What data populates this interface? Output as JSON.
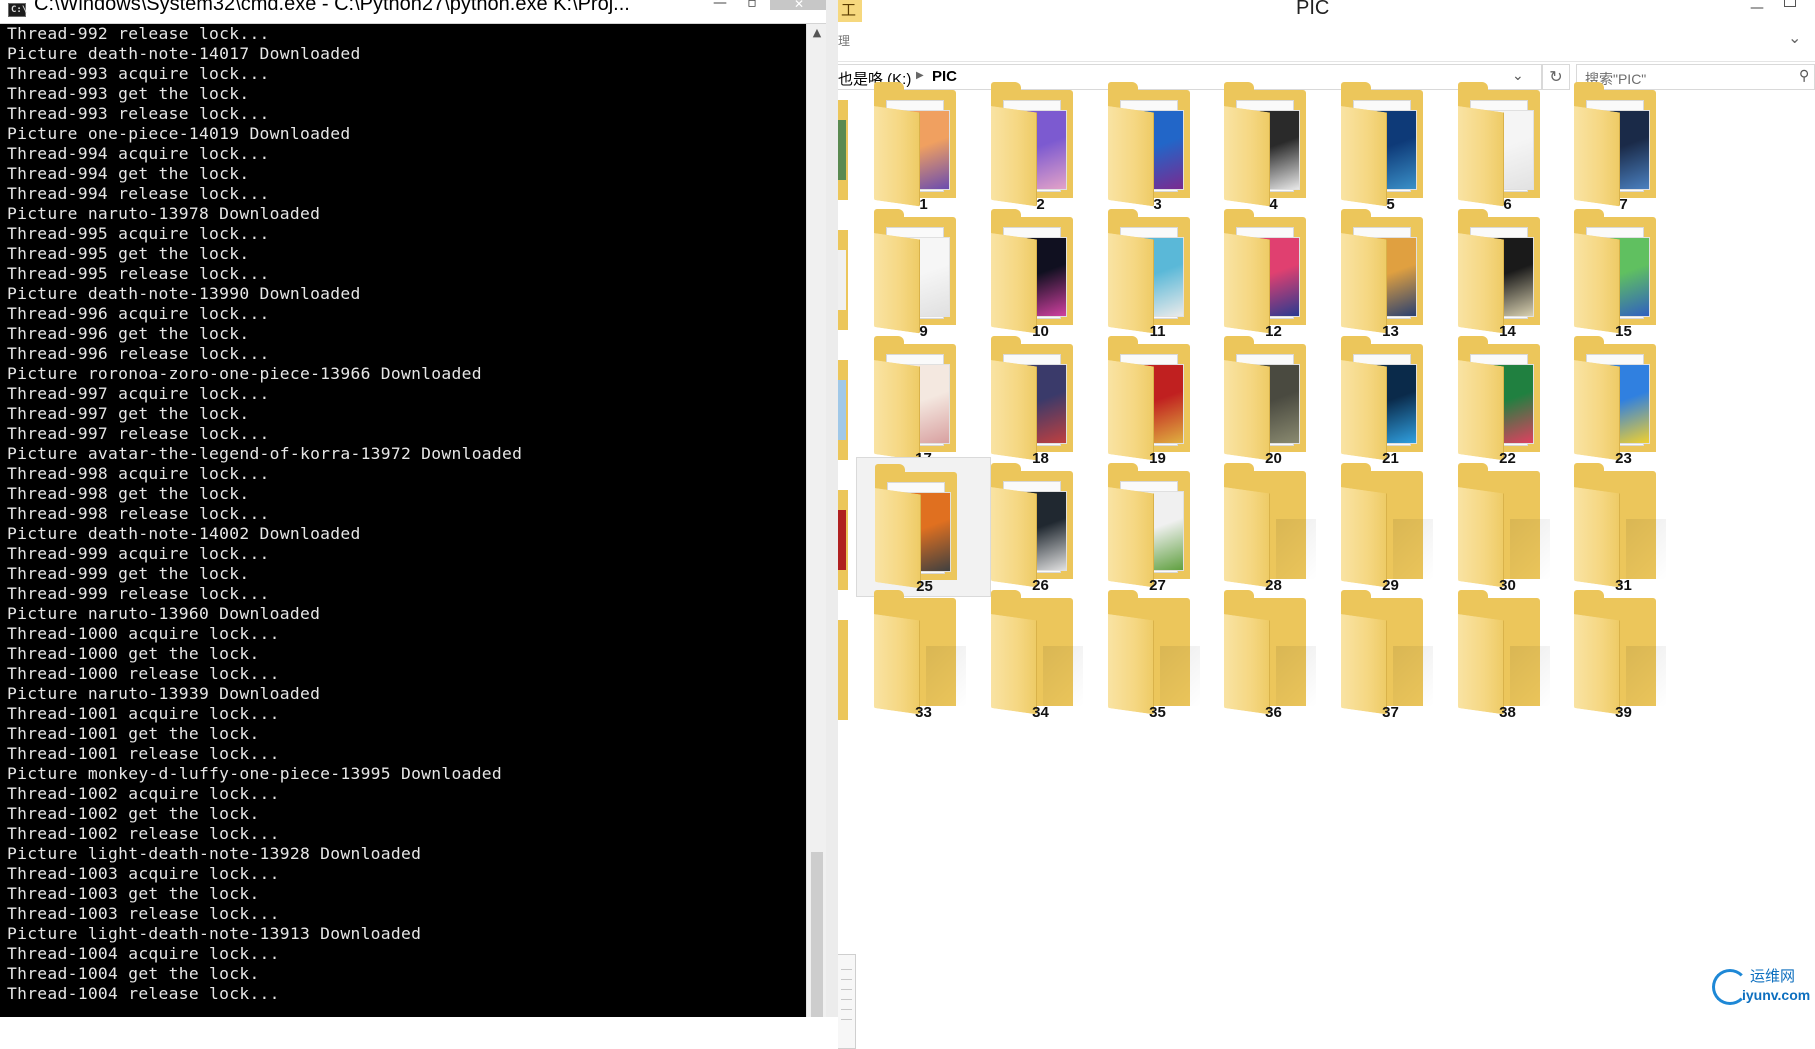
{
  "cmd": {
    "title": "C:\\Windows\\System32\\cmd.exe - C:\\Python27\\python.exe    K:\\Proj...",
    "icon_label": "C:\\",
    "minimize_icon": "minimize-icon",
    "lines": [
      "Thread-992 release lock...",
      "Picture death-note-14017 Downloaded",
      "Thread-993 acquire lock...",
      "Thread-993 get the lock.",
      "Thread-993 release lock...",
      "Picture one-piece-14019 Downloaded",
      "Thread-994 acquire lock...",
      "Thread-994 get the lock.",
      "Thread-994 release lock...",
      "Picture naruto-13978 Downloaded",
      "Thread-995 acquire lock...",
      "Thread-995 get the lock.",
      "Thread-995 release lock...",
      "Picture death-note-13990 Downloaded",
      "Thread-996 acquire lock...",
      "Thread-996 get the lock.",
      "Thread-996 release lock...",
      "Picture roronoa-zoro-one-piece-13966 Downloaded",
      "Thread-997 acquire lock...",
      "Thread-997 get the lock.",
      "Thread-997 release lock...",
      "Picture avatar-the-legend-of-korra-13972 Downloaded",
      "Thread-998 acquire lock...",
      "Thread-998 get the lock.",
      "Thread-998 release lock...",
      "Picture death-note-14002 Downloaded",
      "Thread-999 acquire lock...",
      "Thread-999 get the lock.",
      "Thread-999 release lock...",
      "Picture naruto-13960 Downloaded",
      "Thread-1000 acquire lock...",
      "Thread-1000 get the lock.",
      "Thread-1000 release lock...",
      "Picture naruto-13939 Downloaded",
      "Thread-1001 acquire lock...",
      "Thread-1001 get the lock.",
      "Thread-1001 release lock...",
      "Picture monkey-d-luffy-one-piece-13995 Downloaded",
      "Thread-1002 acquire lock...",
      "Thread-1002 get the lock.",
      "Thread-1002 release lock...",
      "Picture light-death-note-13928 Downloaded",
      "Thread-1003 acquire lock...",
      "Thread-1003 get the lock.",
      "Thread-1003 release lock...",
      "Picture light-death-note-13913 Downloaded",
      "Thread-1004 acquire lock...",
      "Thread-1004 get the lock.",
      "Thread-1004 release lock..."
    ]
  },
  "explorer": {
    "ribbon_tab": "工具",
    "title": "PIC",
    "ribbon_mark": "理",
    "breadcrumb": [
      "也是咯 (K:)",
      "PIC"
    ],
    "search_placeholder": "搜索\"PIC\"",
    "colors": {
      "folder": "#ecc65b",
      "selection": "#f2f2f2",
      "accent": "#1e88d6"
    },
    "folders": [
      {
        "label": "1",
        "thumb": [
          "#f0a060",
          "#6a4cb0"
        ]
      },
      {
        "label": "2",
        "thumb": [
          "#7c5ad0",
          "#e3a2c8"
        ]
      },
      {
        "label": "3",
        "thumb": [
          "#2266c8",
          "#7a2a90"
        ]
      },
      {
        "label": "4",
        "thumb": [
          "#2a2a2a",
          "#e8e8e8"
        ]
      },
      {
        "label": "5",
        "thumb": [
          "#0e3a78",
          "#3a90c8"
        ]
      },
      {
        "label": "6",
        "thumb": [
          "#f5f5f5",
          "#e2e2e2"
        ]
      },
      {
        "label": "7",
        "thumb": [
          "#1a2a48",
          "#4a80c0"
        ]
      },
      {
        "label": "9",
        "thumb": [
          "#f6f6f6",
          "#e0e0e0"
        ]
      },
      {
        "label": "10",
        "thumb": [
          "#101020",
          "#d040a0"
        ]
      },
      {
        "label": "11",
        "thumb": [
          "#5ab8d8",
          "#eaeaea"
        ]
      },
      {
        "label": "12",
        "thumb": [
          "#e04070",
          "#2a3a90"
        ]
      },
      {
        "label": "13",
        "thumb": [
          "#e0a040",
          "#2a4070"
        ]
      },
      {
        "label": "14",
        "thumb": [
          "#1a1a1a",
          "#d8d0b0"
        ]
      },
      {
        "label": "15",
        "thumb": [
          "#60c060",
          "#3060c0"
        ]
      },
      {
        "label": "17",
        "thumb": [
          "#f4e8e0",
          "#d8a0a0"
        ]
      },
      {
        "label": "18",
        "thumb": [
          "#3a3a6a",
          "#c04040"
        ]
      },
      {
        "label": "19",
        "thumb": [
          "#c02020",
          "#e0b040"
        ]
      },
      {
        "label": "20",
        "thumb": [
          "#4a4a40",
          "#8a8a70"
        ]
      },
      {
        "label": "21",
        "thumb": [
          "#0a2a4a",
          "#30a0e0"
        ]
      },
      {
        "label": "22",
        "thumb": [
          "#208040",
          "#e04060"
        ]
      },
      {
        "label": "23",
        "thumb": [
          "#3080e0",
          "#f0d030"
        ]
      },
      {
        "label": "25",
        "thumb": [
          "#e07020",
          "#404040"
        ],
        "selected": true
      },
      {
        "label": "26",
        "thumb": [
          "#202830",
          "#e0e0e0"
        ]
      },
      {
        "label": "27",
        "thumb": [
          "#f0f0f0",
          "#60a040"
        ]
      },
      {
        "label": "28"
      },
      {
        "label": "29"
      },
      {
        "label": "30"
      },
      {
        "label": "31"
      },
      {
        "label": "33"
      },
      {
        "label": "34"
      },
      {
        "label": "35"
      },
      {
        "label": "36"
      },
      {
        "label": "37"
      },
      {
        "label": "38"
      },
      {
        "label": "39"
      }
    ],
    "stubs": [
      {
        "color": "#5a8a50"
      },
      {
        "color": "#f0f0f0"
      },
      {
        "color": "#a0c8e8"
      },
      {
        "color": "#b02020"
      },
      {
        "color": "#ecc65b"
      }
    ]
  },
  "watermark": {
    "cn": "运维网",
    "en": "iyunv.com"
  }
}
